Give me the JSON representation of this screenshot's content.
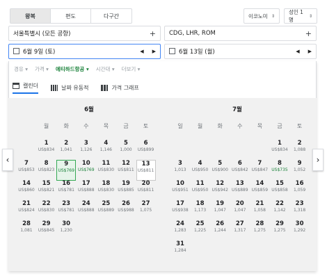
{
  "trip_tabs": [
    "왕복",
    "편도",
    "다구간"
  ],
  "cabin": "이코노미",
  "passengers": "성인 1명",
  "origin": "서울특별시 (모든 공항)",
  "destination": "CDG, LHR, ROM",
  "depart_date": "6월 9일 (토)",
  "return_date": "6월 13일 (월)",
  "filters": [
    {
      "label": "경유",
      "active": false
    },
    {
      "label": "가격",
      "active": false
    },
    {
      "label": "에티하드항공",
      "active": true
    },
    {
      "label": "시간대",
      "active": false
    },
    {
      "label": "더보기",
      "active": false
    }
  ],
  "views": [
    "캘린더",
    "날짜 유동적",
    "가격 그래프"
  ],
  "months": [
    {
      "title": "6월",
      "weekdays": [
        "월",
        "화",
        "수",
        "목",
        "금",
        "토"
      ],
      "days": [
        {
          "d": "1",
          "p": "US$834"
        },
        {
          "d": "2",
          "p": "1,041"
        },
        {
          "d": "3",
          "p": "1,126"
        },
        {
          "d": "4",
          "p": "1,146"
        },
        {
          "d": "5",
          "p": "1,000"
        },
        {
          "d": "6",
          "p": "US$899"
        },
        {
          "d": "7",
          "p": "US$853"
        },
        {
          "d": "8",
          "p": "US$823"
        },
        {
          "d": "9",
          "p": "US$769"
        },
        {
          "d": "10",
          "p": "US$769"
        },
        {
          "d": "11",
          "p": "US$830"
        },
        {
          "d": "12",
          "p": "US$811"
        },
        {
          "d": "13",
          "p": "US$811"
        },
        {
          "d": "14",
          "p": "US$860"
        },
        {
          "d": "15",
          "p": "US$821"
        },
        {
          "d": "16",
          "p": "US$781"
        },
        {
          "d": "17",
          "p": "US$888"
        },
        {
          "d": "18",
          "p": "US$830"
        },
        {
          "d": "19",
          "p": "US$885"
        },
        {
          "d": "20",
          "p": "US$811"
        },
        {
          "d": "21",
          "p": "US$824"
        },
        {
          "d": "22",
          "p": "US$830"
        },
        {
          "d": "23",
          "p": "US$781"
        },
        {
          "d": "24",
          "p": "US$888"
        },
        {
          "d": "25",
          "p": "US$889"
        },
        {
          "d": "26",
          "p": "US$988"
        },
        {
          "d": "27",
          "p": "1,075"
        },
        {
          "d": "28",
          "p": "1,081"
        },
        {
          "d": "29",
          "p": "US$845"
        },
        {
          "d": "30",
          "p": "1,230"
        }
      ]
    },
    {
      "title": "7월",
      "weekdays": [
        "일",
        "월",
        "화",
        "수",
        "목",
        "금",
        "토"
      ],
      "days": [
        {
          "d": "1",
          "p": "US$834"
        },
        {
          "d": "2",
          "p": "1,088"
        },
        {
          "d": "3",
          "p": "1,013"
        },
        {
          "d": "4",
          "p": "US$950"
        },
        {
          "d": "5",
          "p": "US$900"
        },
        {
          "d": "6",
          "p": "US$842"
        },
        {
          "d": "7",
          "p": "US$847"
        },
        {
          "d": "8",
          "p": "US$735"
        },
        {
          "d": "9",
          "p": "1,052"
        },
        {
          "d": "10",
          "p": "US$951"
        },
        {
          "d": "11",
          "p": "US$950"
        },
        {
          "d": "12",
          "p": "US$942"
        },
        {
          "d": "13",
          "p": "US$889"
        },
        {
          "d": "14",
          "p": "US$859"
        },
        {
          "d": "15",
          "p": "US$858"
        },
        {
          "d": "16",
          "p": "1,059"
        },
        {
          "d": "17",
          "p": "US$938"
        },
        {
          "d": "18",
          "p": "1,173"
        },
        {
          "d": "19",
          "p": "1,047"
        },
        {
          "d": "20",
          "p": "1,047"
        },
        {
          "d": "21",
          "p": "1,058"
        },
        {
          "d": "22",
          "p": "1,142"
        },
        {
          "d": "23",
          "p": "1,318"
        },
        {
          "d": "24",
          "p": "1,283"
        },
        {
          "d": "25",
          "p": "1,225"
        },
        {
          "d": "26",
          "p": "1,244"
        },
        {
          "d": "27",
          "p": "1,317"
        },
        {
          "d": "28",
          "p": "1,275"
        },
        {
          "d": "29",
          "p": "1,275"
        },
        {
          "d": "30",
          "p": "1,292"
        },
        {
          "d": "31",
          "p": "1,284"
        }
      ]
    }
  ],
  "colors": {
    "accent": "#1a73e8",
    "green": "#188038",
    "calendar_bg": "#f1f1f1"
  }
}
